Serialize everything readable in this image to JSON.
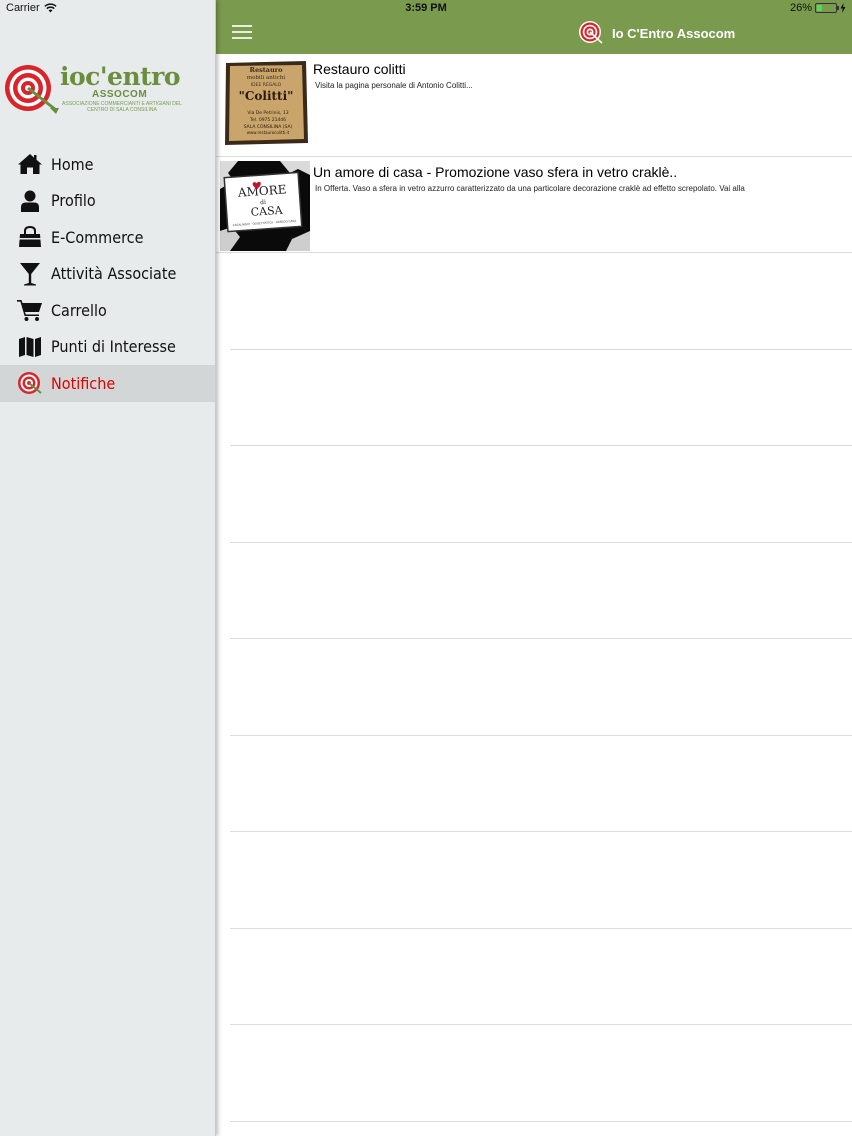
{
  "status_bar": {
    "carrier": "Carrier",
    "time": "3:59 PM",
    "battery": "26%",
    "battery_level": 0.26
  },
  "sidebar": {
    "logo": {
      "brand": "ioc'entro",
      "sub": "ASSOCOM",
      "tagline": "ASSOCIAZIONE COMMERCIANTI E ARTIGIANI DEL CENTRO DI SALA CONSILINA"
    },
    "items": [
      {
        "label": "Home",
        "icon": "home-icon"
      },
      {
        "label": "Profilo",
        "icon": "user-icon"
      },
      {
        "label": "E-Commerce",
        "icon": "shopping-bag-icon"
      },
      {
        "label": "Attività Associate",
        "icon": "cocktail-icon"
      },
      {
        "label": "Carrello",
        "icon": "cart-icon"
      },
      {
        "label": "Punti di Interesse",
        "icon": "map-icon"
      },
      {
        "label": "Notifiche",
        "icon": "target-icon",
        "active": true
      }
    ]
  },
  "navbar": {
    "title": "Io C'Entro Assocom"
  },
  "notifications": [
    {
      "title": "Restauro colitti",
      "subtitle": "Visita la pagina personale di Antonio Colitti...",
      "thumb": {
        "line1": "Restauro",
        "line2": "mobili antichi",
        "line3": "IDEE REGALO",
        "name": "\"Colitti\"",
        "addr1": "Via De Petrinis, 13",
        "addr2": "Tel. 0975 21446",
        "addr3": "SALA CONSILINA (SA)",
        "addr4": "www.restaurocolitti.it"
      }
    },
    {
      "title": "Un amore di casa - Promozione vaso sfera in vetro craklè..",
      "subtitle": "In Offerta. Vaso a sfera in vetro azzurro caratterizzato da una particolare decorazione craklè ad effetto screpolato. Vai alla",
      "thumb": {
        "top": "AMORE",
        "mid": "di",
        "bottom": "CASA",
        "tag": "CASALINGHI · OGGETTISTICA · ARREDO CASA"
      }
    }
  ],
  "colors": {
    "navbar": "#7a9a4d",
    "sidebar": "#e8ebeb",
    "active_label": "#e00000",
    "brand_green": "#6a8e3e"
  }
}
